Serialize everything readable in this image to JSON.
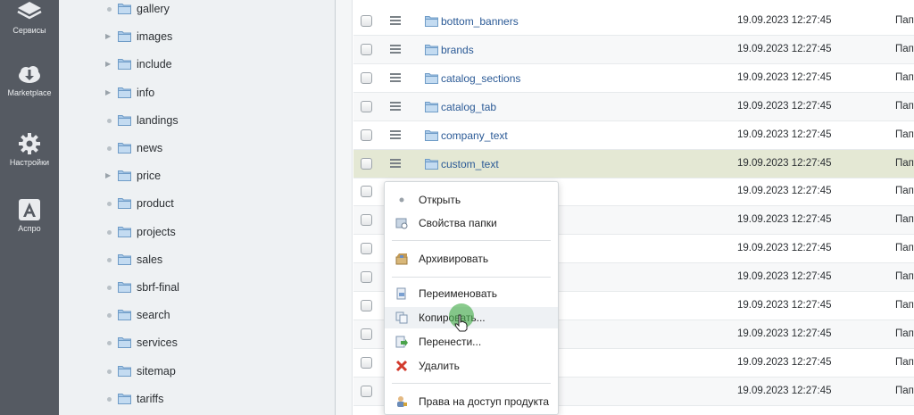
{
  "adminbar": {
    "items": [
      {
        "label": "Сервисы",
        "icon": "layers-icon"
      },
      {
        "label": "Marketplace",
        "icon": "cloud-download-icon"
      },
      {
        "label": "Настройки",
        "icon": "gear-icon"
      },
      {
        "label": "Аспро",
        "icon": "aspro-logo-icon"
      }
    ]
  },
  "tree": {
    "items": [
      {
        "label": "gallery",
        "expandable": false
      },
      {
        "label": "images",
        "expandable": true
      },
      {
        "label": "include",
        "expandable": true
      },
      {
        "label": "info",
        "expandable": true
      },
      {
        "label": "landings",
        "expandable": false
      },
      {
        "label": "news",
        "expandable": false
      },
      {
        "label": "price",
        "expandable": true
      },
      {
        "label": "product",
        "expandable": false
      },
      {
        "label": "projects",
        "expandable": false
      },
      {
        "label": "sales",
        "expandable": false
      },
      {
        "label": "sbrf-final",
        "expandable": false
      },
      {
        "label": "search",
        "expandable": false
      },
      {
        "label": "services",
        "expandable": false
      },
      {
        "label": "sitemap",
        "expandable": false
      },
      {
        "label": "tariffs",
        "expandable": false
      }
    ]
  },
  "grid": {
    "rows": [
      {
        "name": "bottom_banners",
        "date": "19.09.2023 12:27:45",
        "type": "Пап"
      },
      {
        "name": "brands",
        "date": "19.09.2023 12:27:45",
        "type": "Пап"
      },
      {
        "name": "catalog_sections",
        "date": "19.09.2023 12:27:45",
        "type": "Пап"
      },
      {
        "name": "catalog_tab",
        "date": "19.09.2023 12:27:45",
        "type": "Пап"
      },
      {
        "name": "company_text",
        "date": "19.09.2023 12:27:45",
        "type": "Пап"
      },
      {
        "name": "custom_text",
        "date": "19.09.2023 12:27:45",
        "type": "Пап"
      },
      {
        "name": "",
        "date": "19.09.2023 12:27:45",
        "type": "Пап"
      },
      {
        "name": "",
        "date": "19.09.2023 12:27:45",
        "type": "Пап"
      },
      {
        "name": "",
        "date": "19.09.2023 12:27:45",
        "type": "Пап"
      },
      {
        "name": "",
        "date": "19.09.2023 12:27:45",
        "type": "Пап"
      },
      {
        "name": "",
        "date": "19.09.2023 12:27:45",
        "type": "Пап"
      },
      {
        "name": "",
        "date": "19.09.2023 12:27:45",
        "type": "Пап"
      },
      {
        "name": "",
        "date": "19.09.2023 12:27:45",
        "type": "Пап"
      },
      {
        "name": "",
        "date": "19.09.2023 12:27:45",
        "type": "Пап"
      }
    ],
    "active_row": 5
  },
  "context_menu": {
    "open": "Открыть",
    "properties": "Свойства папки",
    "archive": "Архивировать",
    "rename": "Переименовать",
    "copy": "Копировать...",
    "move": "Перенести...",
    "delete": "Удалить",
    "access": "Права на доступ продукта"
  },
  "colors": {
    "adminbar_bg": "#555a62",
    "tree_bg": "#eef1f3",
    "active_row": "#e4e8d4",
    "link": "#2b5a96",
    "folder": "#8fb6dc",
    "cursor_highlight": "#4caf50"
  }
}
